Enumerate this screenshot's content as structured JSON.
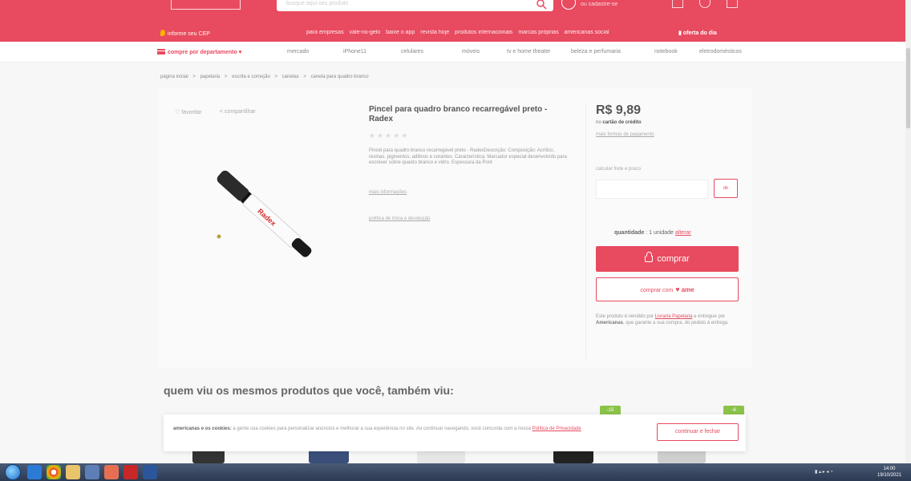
{
  "header": {
    "search_placeholder": "busque aqui seu produto",
    "account": "ou cadastre-se",
    "cep": "informe seu CEP",
    "sub_links": [
      "para empresas",
      "vale-no-gelo",
      "baixe o app",
      "revista hoje",
      "produtos internacionais",
      "marcas próprias",
      "americanas social"
    ],
    "oferta": "oferta do dia"
  },
  "dept_nav": {
    "button": "compre por departamento",
    "items": [
      "mercado",
      "iPhone11",
      "celulares",
      "móveis",
      "tv e home theater",
      "beleza e perfumaria",
      "notebook",
      "eletrodomésticos"
    ]
  },
  "breadcrumb": [
    "página inicial",
    ">",
    "papelaria",
    ">",
    "escrita e correção",
    ">",
    "canetas",
    ">",
    "caneta para quadro branco"
  ],
  "actions": {
    "favorite": "favoritar",
    "share": "compartilhar"
  },
  "product": {
    "title": "Pincel para quadro branco recarregável preto - Radex",
    "stars": "★★★★★",
    "description": "Pincel para quadro branco recarregável preto - RadexDescrição: Composição: Acrílico, resinas, pigmentos, aditivos e corantes. Característica: Marcador especial desenvolvido para escrever sobre quadro branco e vidro. Espessura da Pont",
    "more_info": "mais informações",
    "guarantee": "política de troca e devolução",
    "brand_mark": "Radex"
  },
  "buybox": {
    "price": "R$ 9,89",
    "payment_prefix": "no",
    "payment_method": "cartão de crédito",
    "more_payment": "mais formas de pagamento",
    "shipping_label": "calcular frete e prazo",
    "ok": "ok",
    "qty_label": "quantidade",
    "qty_value": ": 1 unidade",
    "qty_change": "alterar",
    "buy": "comprar",
    "ame_prefix": "comprar com",
    "ame": "ame",
    "seller_text_1": "Este produto é vendido por",
    "seller_name": "Livraria Papelaria",
    "seller_text_2": "e entregue por",
    "seller_deliver": "Americanas",
    "seller_text_3": ", que garante a sua compra, do pedido à entrega."
  },
  "recommendations": {
    "title": "quem viu os mesmos produtos que você, também viu:",
    "badges": [
      "-15",
      "-6"
    ]
  },
  "cookie": {
    "bold": "americanas e os cookies:",
    "text": "a gente usa cookies para personalizar anúncios e melhorar a sua experiência no site. Ao continuar navegando, você concorda com a nossa",
    "link": "Política de Privacidade",
    "button": "continuar e fechar"
  },
  "taskbar": {
    "clock_time": "14:00",
    "clock_date": "19/10/2021"
  },
  "colors": {
    "brand": "#e84a5f",
    "badge": "#8bc34a"
  }
}
